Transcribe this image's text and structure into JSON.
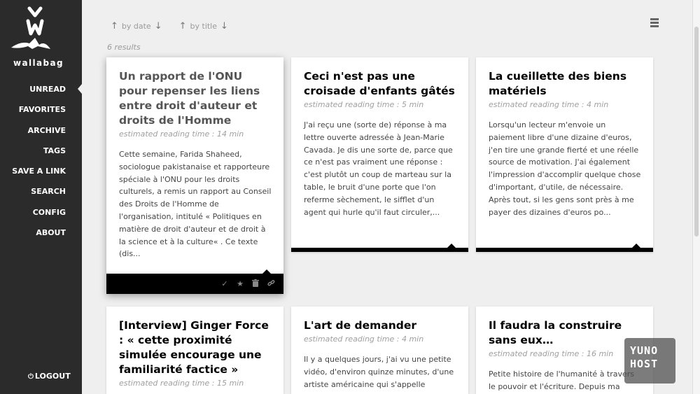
{
  "sidebar": {
    "brand": "wallabag",
    "items": [
      {
        "label": "UNREAD",
        "active": true
      },
      {
        "label": "FAVORITES"
      },
      {
        "label": "ARCHIVE"
      },
      {
        "label": "TAGS"
      },
      {
        "label": "SAVE A LINK"
      },
      {
        "label": "SEARCH"
      },
      {
        "label": "CONFIG"
      },
      {
        "label": "ABOUT"
      }
    ],
    "logout": "LOGOUT",
    "logout_icon": "power-icon"
  },
  "sort": {
    "by_date": "by date",
    "by_title": "by title"
  },
  "results": "6 results",
  "cards": [
    {
      "title": "Un rapport de l'ONU pour repenser les liens entre droit d'auteur et droits de l'Homme",
      "reading_time": "estimated reading time : 14 min",
      "excerpt": "Cette semaine, Farida Shaheed, sociologue pakistanaise et rapporteure spéciale à l'ONU pour les droits culturels, a remis un rapport au Conseil des Droits de l'Homme de l'organisation, intitulé « Politiques en matière de droit d'auteur et de droit à la science et à la culture« . Ce texte (dis..."
    },
    {
      "title": "Ceci n'est pas une croisade d'enfants gâtés",
      "reading_time": "estimated reading time : 5 min",
      "excerpt": "J'ai reçu une (sorte de) réponse à ma lettre ouverte adressée à Jean-Marie Cavada. Je dis une sorte de, parce que ce n'est pas vraiment une réponse : c'est plutôt un coup de marteau sur la table, le bruit d'une porte que l'on referme sèchement, le sifflet d'un agent qui hurle qu'il faut circuler,..."
    },
    {
      "title": "La cueillette des biens matériels",
      "reading_time": "estimated reading time : 4 min",
      "excerpt": "Lorsqu'un lecteur m'envoie un paiement libre d'une dizaine d'euros, j'en tire une grande fierté et une réelle source de motivation. J'ai également l'impression d'accomplir quelque chose d'important, d'utile, de nécessaire. Après tout, si les gens sont près à me payer des dizaines d'euros po..."
    },
    {
      "title": "[Interview] Ginger Force : « cette proximité simulée encourage une familiarité factice »",
      "reading_time": "estimated reading time : 15 min",
      "excerpt": ""
    },
    {
      "title": "L'art de demander",
      "reading_time": "estimated reading time : 4 min",
      "excerpt": "Il y a quelques jours, j'ai vu une petite vidéo, d'environ quinze minutes, d'une artiste américaine qui s'appelle"
    },
    {
      "title": "Il faudra la construire sans eux…",
      "reading_time": "estimated reading time : 16 min",
      "excerpt": "Petite histoire de l'humanité à travers le pouvoir et l'écriture. Depuis ma"
    }
  ],
  "card_actions": {
    "mark_read": "✓",
    "favorite": "★",
    "delete": "🗑",
    "link": "🔗"
  },
  "badge": {
    "line1": "YUNO",
    "line2": "HOST"
  }
}
